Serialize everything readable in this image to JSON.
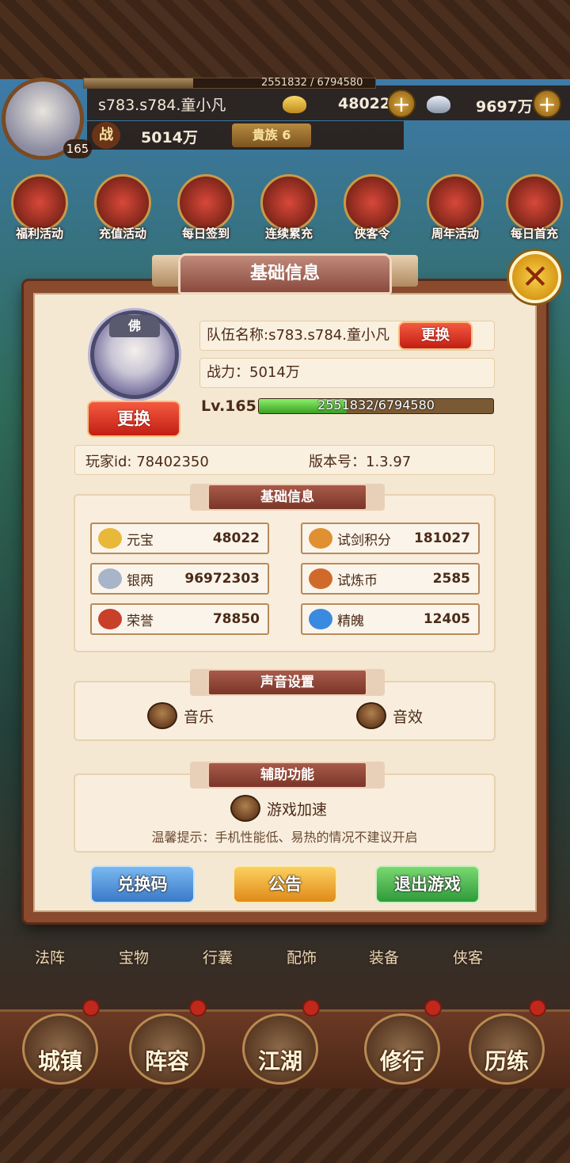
{
  "hud": {
    "exp_text": "2551832 / 6794580",
    "exp_fraction": 0.376,
    "player_name": "s783.s784.童小凡",
    "level": "165",
    "gold": "48022",
    "silver": "9697万",
    "power_icon": "战",
    "power": "5014万",
    "noble": "貴族 6",
    "plus": "+"
  },
  "activities": [
    "福利活动",
    "充值活动",
    "每日签到",
    "连续累充",
    "侠客令",
    "周年活动",
    "每日首充"
  ],
  "sub_nav": [
    "法阵",
    "宝物",
    "行囊",
    "配饰",
    "装备",
    "侠客"
  ],
  "bottom_nav": [
    "城镇",
    "阵容",
    "江湖",
    "修行",
    "历练"
  ],
  "dialog": {
    "title": "基础信息",
    "close": "✕",
    "avatar_hat": "佛",
    "team_name": "队伍名称:s783.s784.童小凡",
    "change": "更换",
    "change_avatar": "更换",
    "power": "战力：5014万",
    "level": "Lv.165",
    "exp": "2551832/6794580",
    "exp_fraction": 0.376,
    "player_id": "玩家id: 78402350",
    "version": "版本号：1.3.97",
    "section_basic": "基础信息",
    "resources": [
      {
        "label": "元宝",
        "value": "48022",
        "icon": "gold-ingot-icon",
        "color": "#e8b838"
      },
      {
        "label": "试剑积分",
        "value": "181027",
        "icon": "sword-token-icon",
        "color": "#e09030"
      },
      {
        "label": "银两",
        "value": "96972303",
        "icon": "silver-ingot-icon",
        "color": "#a8b4c8"
      },
      {
        "label": "试炼币",
        "value": "2585",
        "icon": "trial-coin-icon",
        "color": "#d06a2a"
      },
      {
        "label": "荣誉",
        "value": "78850",
        "icon": "honor-icon",
        "color": "#c8402a"
      },
      {
        "label": "精魄",
        "value": "12405",
        "icon": "spirit-icon",
        "color": "#3a8ae0"
      }
    ],
    "section_sound": "声音设置",
    "music": "音乐",
    "sfx": "音效",
    "section_assist": "辅助功能",
    "speedup": "游戏加速",
    "tip": "温馨提示：手机性能低、易热的情况不建议开启",
    "redeem": "兑换码",
    "notice": "公告",
    "quit": "退出游戏"
  }
}
